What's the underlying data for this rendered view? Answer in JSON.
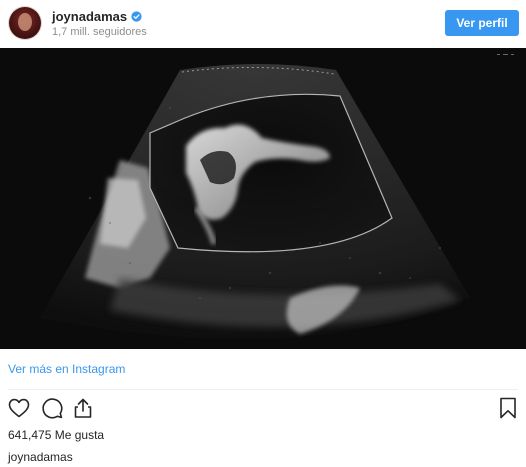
{
  "post": {
    "username": "joynadamas",
    "followers": "1,7 mill. seguidores",
    "view_profile_label": "Ver perfil",
    "view_more_label": "Ver más en Instagram",
    "likes": "641,475 Me gusta",
    "caption_username": "joynadamas"
  },
  "icons": {
    "verified": "verified-badge-icon",
    "like": "heart-icon",
    "comment": "comment-icon",
    "share": "share-icon",
    "save": "bookmark-icon"
  },
  "colors": {
    "accent": "#3897f0",
    "text": "#262626",
    "muted": "#8e8e8e"
  }
}
